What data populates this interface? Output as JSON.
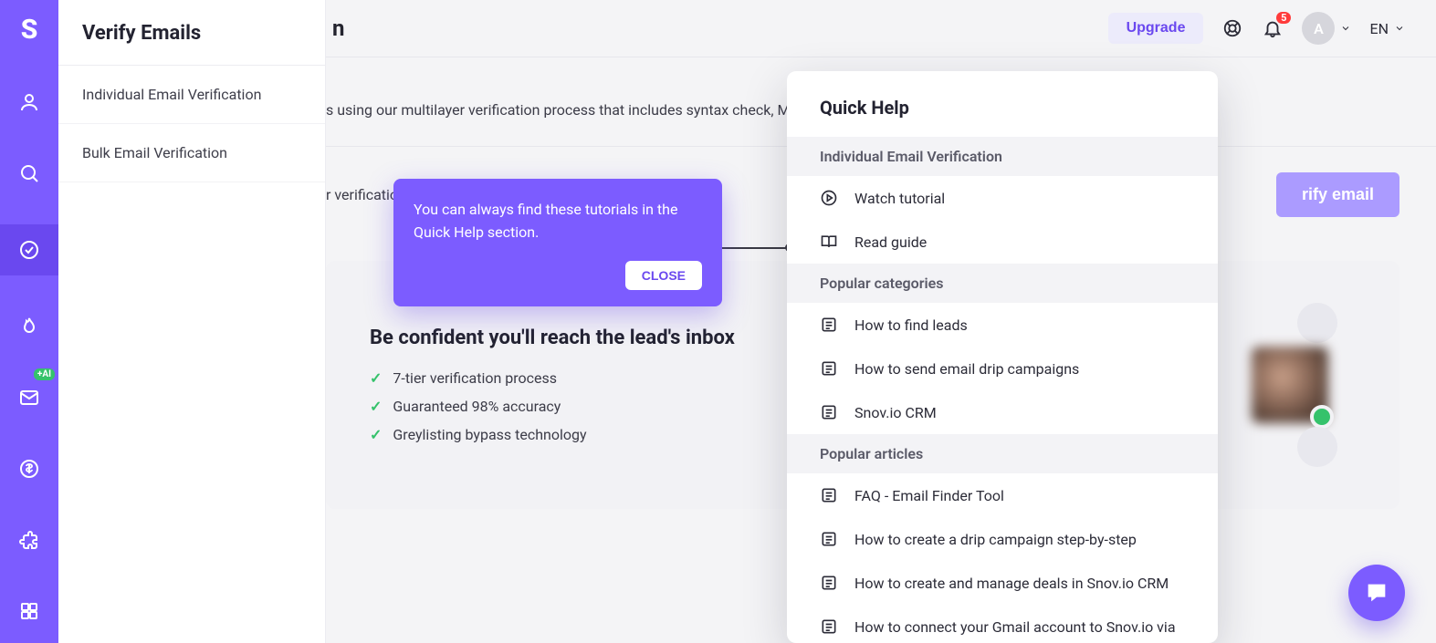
{
  "header": {
    "page_title_peek": "n",
    "upgrade_label": "Upgrade",
    "notification_count": "5",
    "avatar_initial": "A",
    "language": "EN"
  },
  "submenu": {
    "title": "Verify Emails",
    "items": [
      {
        "label": "Individual Email Verification"
      },
      {
        "label": "Bulk Email Verification"
      }
    ]
  },
  "rail": {
    "ai_badge": "+AI"
  },
  "main": {
    "description": "s using our multilayer verification process that includes syntax check, M",
    "input_label": "r verificatio",
    "verify_button": "rify email",
    "confident": {
      "heading": "Be confident you'll reach the lead's inbox",
      "features": [
        "7-tier verification process",
        "Guaranteed 98% accuracy",
        "Greylisting bypass technology"
      ]
    }
  },
  "tooltip": {
    "text": "You can always find these tutorials in the Quick Help section.",
    "close_label": "CLOSE"
  },
  "quickhelp": {
    "title": "Quick Help",
    "section1": "Individual Email Verification",
    "watch_tutorial": "Watch tutorial",
    "read_guide": "Read guide",
    "section2": "Popular categories",
    "categories": [
      "How to find leads",
      "How to send email drip campaigns",
      "Snov.io CRM"
    ],
    "section3": "Popular articles",
    "articles": [
      "FAQ - Email Finder Tool",
      "How to create a drip campaign step-by-step",
      "How to create and manage deals in Snov.io CRM",
      "How to connect your Gmail account to Snov.io via"
    ]
  }
}
